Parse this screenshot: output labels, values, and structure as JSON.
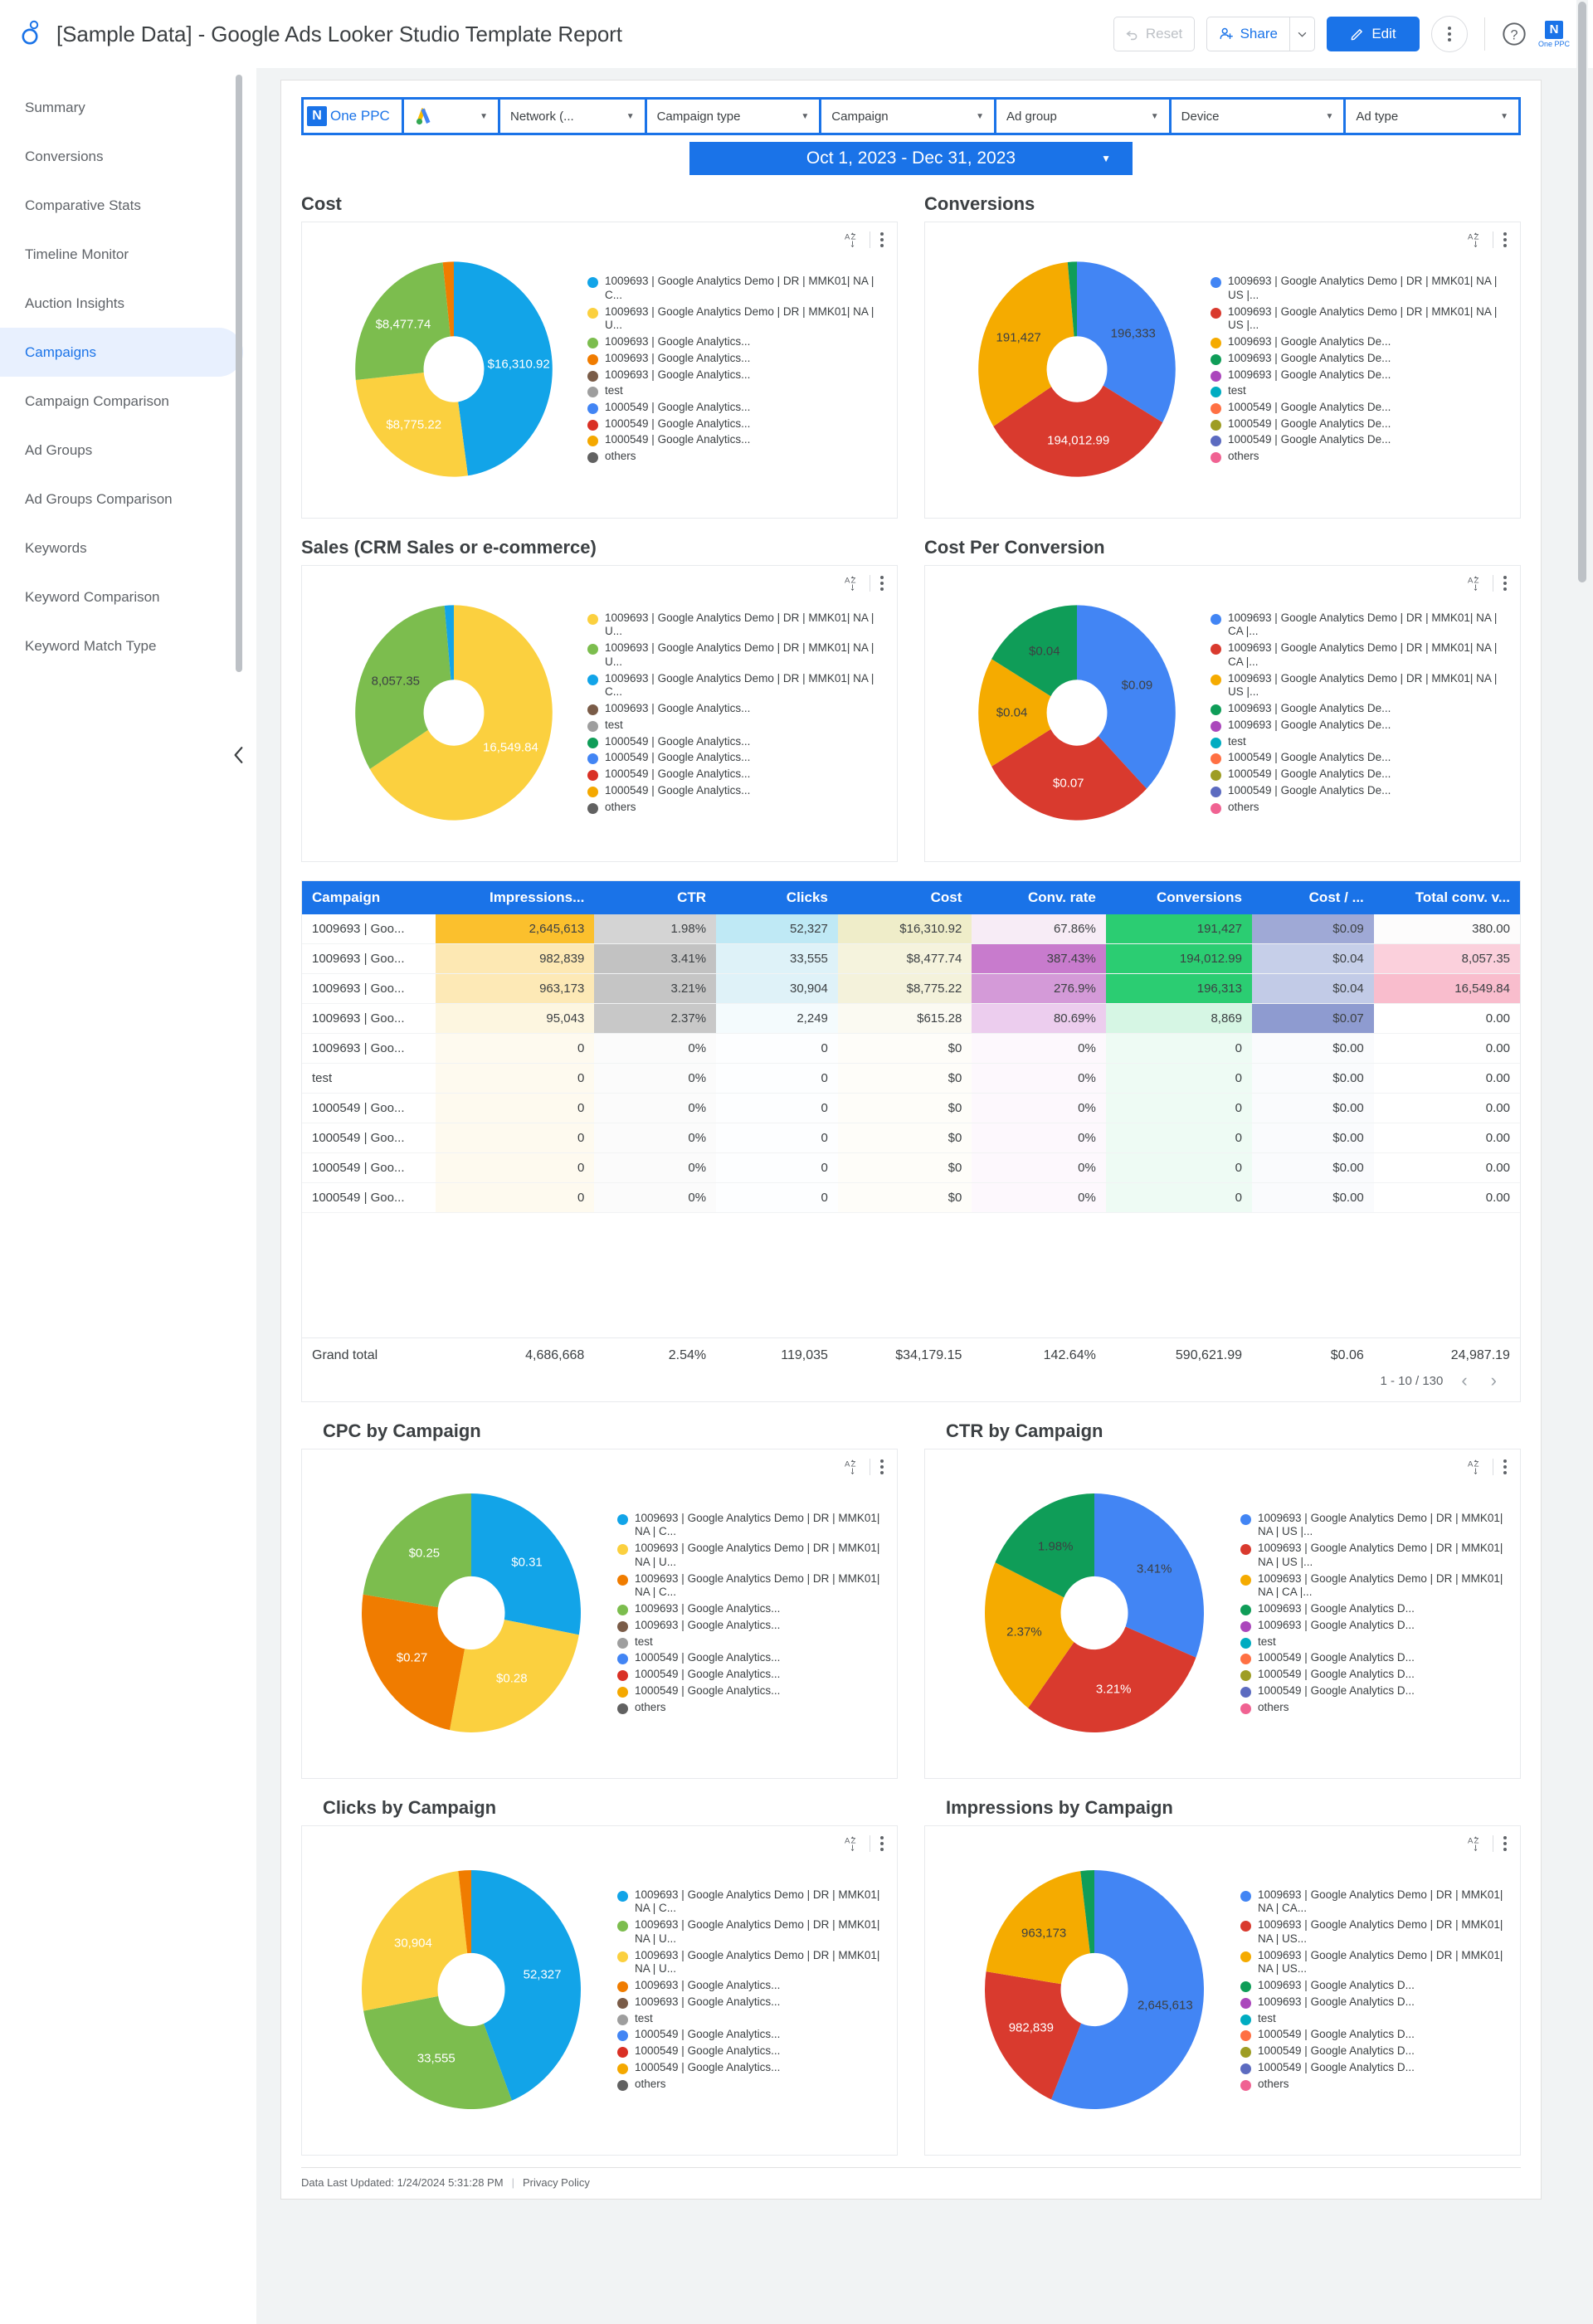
{
  "header": {
    "title": "[Sample Data] - Google Ads Looker Studio Template Report",
    "reset_label": "Reset",
    "share_label": "Share",
    "edit_label": "Edit",
    "logo_mark": "N",
    "logo_text": "One PPC"
  },
  "sidebar": {
    "items": [
      {
        "label": "Summary",
        "active": false
      },
      {
        "label": "Conversions",
        "active": false
      },
      {
        "label": "Comparative Stats",
        "active": false
      },
      {
        "label": "Timeline Monitor",
        "active": false
      },
      {
        "label": "Auction Insights",
        "active": false
      },
      {
        "label": "Campaigns",
        "active": true
      },
      {
        "label": "Campaign Comparison",
        "active": false
      },
      {
        "label": "Ad Groups",
        "active": false
      },
      {
        "label": "Ad Groups Comparison",
        "active": false
      },
      {
        "label": "Keywords",
        "active": false
      },
      {
        "label": "Keyword Comparison",
        "active": false
      },
      {
        "label": "Keyword Match Type",
        "active": false
      }
    ]
  },
  "filters": {
    "brand_mark": "N",
    "brand_label": "One PPC",
    "chips": [
      {
        "label": "Network (...",
        "width": "w-net"
      },
      {
        "label": "Campaign type",
        "width": "w-std"
      },
      {
        "label": "Campaign",
        "width": "w-std"
      },
      {
        "label": "Ad group",
        "width": "w-std"
      },
      {
        "label": "Device",
        "width": "w-std"
      },
      {
        "label": "Ad type",
        "width": "w-std"
      }
    ],
    "date_range": "Oct 1, 2023 - Dec 31, 2023"
  },
  "chart_data": [
    {
      "id": "cost",
      "type": "pie",
      "title": "Cost",
      "legend_position": "right",
      "labels": [
        "$16,310.92",
        "$8,775.22",
        "$8,477.74",
        "",
        "",
        "",
        "",
        "",
        "",
        ""
      ],
      "values": [
        16310.92,
        8775.22,
        8477.74,
        615.28,
        0,
        0,
        0,
        0,
        0,
        0
      ],
      "colors": [
        "#12a4e8",
        "#fbd03f",
        "#7cbd4e",
        "#f07c00",
        "#7a5c48",
        "#9e9e9e",
        "#4285f4",
        "#d93025",
        "#f4a800",
        "#616161"
      ],
      "slice_label_colors": [
        "w",
        "w",
        "w",
        "w"
      ],
      "legend": [
        "1009693 | Google Analytics Demo | DR | MMK01| NA | C...",
        "1009693 | Google Analytics Demo | DR | MMK01| NA | U...",
        "1009693 | Google Analytics...",
        "1009693 | Google Analytics...",
        "1009693 | Google Analytics...",
        "test",
        "1000549 | Google Analytics...",
        "1000549 | Google Analytics...",
        "1000549 | Google Analytics...",
        "others"
      ]
    },
    {
      "id": "conversions",
      "type": "pie",
      "title": "Conversions",
      "legend_position": "right",
      "labels": [
        "196,333",
        "194,012.99",
        "191,427",
        "",
        "",
        "",
        "",
        "",
        "",
        ""
      ],
      "values": [
        196333,
        194012.99,
        191427,
        8869,
        0,
        0,
        0,
        0,
        0,
        0
      ],
      "colors": [
        "#4285f4",
        "#d93a2e",
        "#f5ab00",
        "#0f9d58",
        "#ab47bc",
        "#00acc1",
        "#ff7043",
        "#9e9d24",
        "#5c6bc0",
        "#f06292"
      ],
      "slice_label_colors": [
        "d",
        "w",
        "d",
        "d"
      ],
      "legend": [
        "1009693 | Google Analytics Demo | DR | MMK01| NA | US |...",
        "1009693 | Google Analytics Demo | DR | MMK01| NA | US |...",
        "1009693 | Google Analytics De...",
        "1009693 | Google Analytics De...",
        "1009693 | Google Analytics De...",
        "test",
        "1000549 | Google Analytics De...",
        "1000549 | Google Analytics De...",
        "1000549 | Google Analytics De...",
        "others"
      ]
    },
    {
      "id": "sales",
      "type": "pie",
      "title": "Sales (CRM Sales or e-commerce)",
      "legend_position": "right",
      "labels": [
        "16,549.84",
        "8,057.35",
        "",
        "",
        "",
        "",
        "",
        "",
        "",
        ""
      ],
      "values": [
        16549.84,
        8057.35,
        380,
        0,
        0,
        0,
        0,
        0,
        0,
        0
      ],
      "colors": [
        "#fbd03f",
        "#7cbd4e",
        "#12a4e8",
        "#7a5c48",
        "#9e9e9e",
        "#0f9d58",
        "#4285f4",
        "#d93025",
        "#f4a800",
        "#616161"
      ],
      "slice_label_colors": [
        "w",
        "d",
        "w"
      ],
      "legend": [
        "1009693 | Google Analytics Demo | DR | MMK01| NA | U...",
        "1009693 | Google Analytics Demo | DR | MMK01| NA | U...",
        "1009693 | Google Analytics Demo | DR | MMK01| NA | C...",
        "1009693 | Google Analytics...",
        "test",
        "1000549 | Google Analytics...",
        "1000549 | Google Analytics...",
        "1000549 | Google Analytics...",
        "1000549 | Google Analytics...",
        "others"
      ]
    },
    {
      "id": "cost_per_conversion",
      "type": "pie",
      "title": "Cost Per Conversion",
      "legend_position": "right",
      "labels": [
        "$0.09",
        "$0.07",
        "$0.04",
        "$0.04",
        "",
        "",
        "",
        "",
        "",
        ""
      ],
      "values": [
        0.09,
        0.07,
        0.04,
        0.04,
        0,
        0,
        0,
        0,
        0,
        0
      ],
      "colors": [
        "#4285f4",
        "#d93a2e",
        "#f5ab00",
        "#0f9d58",
        "#ab47bc",
        "#00acc1",
        "#ff7043",
        "#9e9d24",
        "#5c6bc0",
        "#f06292"
      ],
      "slice_label_colors": [
        "d",
        "w",
        "d",
        "d"
      ],
      "legend": [
        "1009693 | Google Analytics Demo | DR | MMK01| NA | CA |...",
        "1009693 | Google Analytics Demo | DR | MMK01| NA | CA |...",
        "1009693 | Google Analytics Demo | DR | MMK01| NA | US |...",
        "1009693 | Google Analytics De...",
        "1009693 | Google Analytics De...",
        "test",
        "1000549 | Google Analytics De...",
        "1000549 | Google Analytics De...",
        "1000549 | Google Analytics De...",
        "others"
      ]
    },
    {
      "id": "cpc_by_campaign",
      "type": "pie",
      "title": "CPC by Campaign",
      "legend_position": "right",
      "labels": [
        "$0.31",
        "$0.28",
        "$0.27",
        "$0.25",
        "",
        "",
        "",
        "",
        "",
        ""
      ],
      "values": [
        0.31,
        0.28,
        0.27,
        0.25,
        0,
        0,
        0,
        0,
        0,
        0
      ],
      "colors": [
        "#12a4e8",
        "#fbd03f",
        "#f07c00",
        "#7cbd4e",
        "#7a5c48",
        "#9e9e9e",
        "#4285f4",
        "#d93025",
        "#f4a800",
        "#616161"
      ],
      "slice_label_colors": [
        "w",
        "w",
        "w",
        "w"
      ],
      "legend": [
        "1009693 | Google Analytics Demo | DR | MMK01| NA | C...",
        "1009693 | Google Analytics Demo | DR | MMK01| NA | U...",
        "1009693 | Google Analytics Demo | DR | MMK01| NA | C...",
        "1009693 | Google Analytics...",
        "1009693 | Google Analytics...",
        "test",
        "1000549 | Google Analytics...",
        "1000549 | Google Analytics...",
        "1000549 | Google Analytics...",
        "others"
      ]
    },
    {
      "id": "ctr_by_campaign",
      "type": "pie",
      "title": "CTR by Campaign",
      "legend_position": "right",
      "labels": [
        "3.41%",
        "3.21%",
        "2.37%",
        "1.98%",
        "",
        "",
        "",
        "",
        "",
        ""
      ],
      "values": [
        3.41,
        3.21,
        2.37,
        1.98,
        0,
        0,
        0,
        0,
        0,
        0
      ],
      "colors": [
        "#4285f4",
        "#d93a2e",
        "#f5ab00",
        "#0f9d58",
        "#ab47bc",
        "#00acc1",
        "#ff7043",
        "#9e9d24",
        "#5c6bc0",
        "#f06292"
      ],
      "slice_label_colors": [
        "d",
        "w",
        "d",
        "d"
      ],
      "legend": [
        "1009693 | Google Analytics Demo | DR | MMK01| NA | US |...",
        "1009693 | Google Analytics Demo | DR | MMK01| NA | US |...",
        "1009693 | Google Analytics Demo | DR | MMK01| NA | CA |...",
        "1009693 | Google Analytics D...",
        "1009693 | Google Analytics D...",
        "test",
        "1000549 | Google Analytics D...",
        "1000549 | Google Analytics D...",
        "1000549 | Google Analytics D...",
        "others"
      ]
    },
    {
      "id": "clicks_by_campaign",
      "type": "pie",
      "title": "Clicks by Campaign",
      "legend_position": "right",
      "labels": [
        "52,327",
        "33,555",
        "30,904",
        "",
        "",
        "",
        "",
        "",
        "",
        ""
      ],
      "values": [
        52327,
        33555,
        30904,
        2249,
        0,
        0,
        0,
        0,
        0,
        0
      ],
      "colors": [
        "#12a4e8",
        "#7cbd4e",
        "#fbd03f",
        "#f07c00",
        "#7a5c48",
        "#9e9e9e",
        "#4285f4",
        "#d93025",
        "#f4a800",
        "#616161"
      ],
      "slice_label_colors": [
        "w",
        "w",
        "w"
      ],
      "legend": [
        "1009693 | Google Analytics Demo | DR | MMK01| NA | C...",
        "1009693 | Google Analytics Demo | DR | MMK01| NA | U...",
        "1009693 | Google Analytics Demo | DR | MMK01| NA | U...",
        "1009693 | Google Analytics...",
        "1009693 | Google Analytics...",
        "test",
        "1000549 | Google Analytics...",
        "1000549 | Google Analytics...",
        "1000549 | Google Analytics...",
        "others"
      ]
    },
    {
      "id": "impressions_by_campaign",
      "type": "pie",
      "title": "Impressions by Campaign",
      "legend_position": "right",
      "labels": [
        "2,645,613",
        "982,839",
        "963,173",
        "",
        "",
        "",
        "",
        "",
        "",
        ""
      ],
      "values": [
        2645613,
        982839,
        963173,
        95043,
        0,
        0,
        0,
        0,
        0,
        0
      ],
      "colors": [
        "#4285f4",
        "#d93a2e",
        "#f5ab00",
        "#0f9d58",
        "#ab47bc",
        "#00acc1",
        "#ff7043",
        "#9e9d24",
        "#5c6bc0",
        "#f06292"
      ],
      "slice_label_colors": [
        "d",
        "w",
        "d"
      ],
      "legend": [
        "1009693 | Google Analytics Demo | DR | MMK01| NA | CA...",
        "1009693 | Google Analytics Demo | DR | MMK01| NA | US...",
        "1009693 | Google Analytics Demo | DR | MMK01| NA | US...",
        "1009693 | Google Analytics D...",
        "1009693 | Google Analytics D...",
        "test",
        "1000549 | Google Analytics D...",
        "1000549 | Google Analytics D...",
        "1000549 | Google Analytics D...",
        "others"
      ]
    }
  ],
  "table": {
    "columns": [
      "Campaign",
      "Impressions...",
      "CTR",
      "Clicks",
      "Cost",
      "Conv. rate",
      "Conversions",
      "Cost / ...",
      "Total conv. v..."
    ],
    "rows": [
      {
        "cells": [
          "1009693 | Goo...",
          "2,645,613",
          "1.98%",
          "52,327",
          "$16,310.92",
          "67.86%",
          "191,427",
          "$0.09",
          "380.00"
        ],
        "bg": [
          "",
          "#fbc02d",
          "#d4d4d4",
          "#bfe9f5",
          "#efedc9",
          "#f7ecf6",
          "#2bcd72",
          "#9fa9d6",
          "#fdfcfc"
        ]
      },
      {
        "cells": [
          "1009693 | Goo...",
          "982,839",
          "3.41%",
          "33,555",
          "$8,477.74",
          "387.43%",
          "194,012.99",
          "$0.04",
          "8,057.35"
        ],
        "bg": [
          "",
          "#fde8b3",
          "#c2c2c2",
          "#def2f8",
          "#f5f3dd",
          "#c87bcd",
          "#2bcd72",
          "#c6cfe9",
          "#fbd0dc"
        ]
      },
      {
        "cells": [
          "1009693 | Goo...",
          "963,173",
          "3.21%",
          "30,904",
          "$8,775.22",
          "276.9%",
          "196,313",
          "$0.04",
          "16,549.84"
        ],
        "bg": [
          "",
          "#fde9b6",
          "#c5c5c5",
          "#dff2f8",
          "#f4f2db",
          "#d49ad8",
          "#2bcd72",
          "#c2cbe7",
          "#f9bdcd"
        ]
      },
      {
        "cells": [
          "1009693 | Goo...",
          "95,043",
          "2.37%",
          "2,249",
          "$615.28",
          "80.69%",
          "8,869",
          "$0.07",
          "0.00"
        ],
        "bg": [
          "",
          "#fdf6e0",
          "#c8c8c8",
          "#f4fbfd",
          "#fbfaf2",
          "#eccdee",
          "#d6f6e4",
          "#8e9bd0",
          "#ffffff"
        ]
      },
      {
        "cells": [
          "1009693 | Goo...",
          "0",
          "0%",
          "0",
          "$0",
          "0%",
          "0",
          "$0.00",
          "0.00"
        ],
        "bg": [
          "",
          "#fefaef",
          "#fbfbfb",
          "#fdfeff",
          "#fefdf9",
          "#fdf8fd",
          "#eefbf4",
          "#fafbfd",
          "#ffffff"
        ]
      },
      {
        "cells": [
          "test",
          "0",
          "0%",
          "0",
          "$0",
          "0%",
          "0",
          "$0.00",
          "0.00"
        ],
        "bg": [
          "",
          "#fefaef",
          "#fbfbfb",
          "#fdfeff",
          "#fefdf9",
          "#fdf8fd",
          "#eefbf4",
          "#fafbfd",
          "#ffffff"
        ]
      },
      {
        "cells": [
          "1000549 | Goo...",
          "0",
          "0%",
          "0",
          "$0",
          "0%",
          "0",
          "$0.00",
          "0.00"
        ],
        "bg": [
          "",
          "#fefaef",
          "#fbfbfb",
          "#fdfeff",
          "#fefdf9",
          "#fdf8fd",
          "#eefbf4",
          "#fafbfd",
          "#ffffff"
        ]
      },
      {
        "cells": [
          "1000549 | Goo...",
          "0",
          "0%",
          "0",
          "$0",
          "0%",
          "0",
          "$0.00",
          "0.00"
        ],
        "bg": [
          "",
          "#fefaef",
          "#fbfbfb",
          "#fdfeff",
          "#fefdf9",
          "#fdf8fd",
          "#eefbf4",
          "#fafbfd",
          "#ffffff"
        ]
      },
      {
        "cells": [
          "1000549 | Goo...",
          "0",
          "0%",
          "0",
          "$0",
          "0%",
          "0",
          "$0.00",
          "0.00"
        ],
        "bg": [
          "",
          "#fefaef",
          "#fbfbfb",
          "#fdfeff",
          "#fefdf9",
          "#fdf8fd",
          "#eefbf4",
          "#fafbfd",
          "#ffffff"
        ]
      },
      {
        "cells": [
          "1000549 | Goo...",
          "0",
          "0%",
          "0",
          "$0",
          "0%",
          "0",
          "$0.00",
          "0.00"
        ],
        "bg": [
          "",
          "#fefaef",
          "#fbfbfb",
          "#fdfeff",
          "#fefdf9",
          "#fdf8fd",
          "#eefbf4",
          "#fafbfd",
          "#ffffff"
        ]
      }
    ],
    "grand_total": [
      "Grand total",
      "4,686,668",
      "2.54%",
      "119,035",
      "$34,179.15",
      "142.64%",
      "590,621.99",
      "$0.06",
      "24,987.19"
    ],
    "pagination": "1 - 10 / 130"
  },
  "footer": {
    "updated": "Data Last Updated: 1/24/2024 5:31:28 PM",
    "privacy": "Privacy Policy"
  }
}
